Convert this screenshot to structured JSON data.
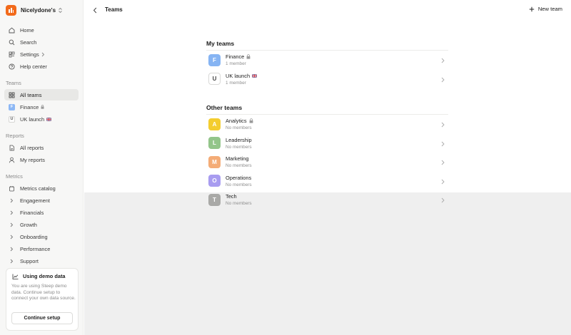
{
  "workspace": {
    "name": "Nicelydone's",
    "accent": "#f26a1b"
  },
  "nav": {
    "home": "Home",
    "search": "Search",
    "settings": "Settings",
    "help": "Help center"
  },
  "teams_section": {
    "label": "Teams",
    "all_teams": "All teams",
    "items": [
      {
        "letter": "F",
        "name": "Finance",
        "bg": "#8db8f5"
      },
      {
        "letter": "U",
        "name": "UK launch"
      }
    ]
  },
  "reports_section": {
    "label": "Reports",
    "all_reports": "All reports",
    "my_reports": "My reports"
  },
  "metrics_section": {
    "label": "Metrics",
    "catalog": "Metrics catalog",
    "groups": [
      "Engagement",
      "Financials",
      "Growth",
      "Onboarding",
      "Performance",
      "Support"
    ]
  },
  "demo": {
    "title": "Using demo data",
    "text": "You are using Steep demo data. Continue setup to connect your own data source.",
    "button": "Continue setup"
  },
  "header": {
    "title": "Teams",
    "new_team": "New team"
  },
  "my_teams": {
    "title": "My teams",
    "rows": [
      {
        "letter": "F",
        "name": "Finance",
        "sub": "1 member",
        "color": "#86b4f3"
      },
      {
        "letter": "U",
        "name": "UK launch",
        "sub": "1 member"
      }
    ]
  },
  "other_teams": {
    "title": "Other teams",
    "rows": [
      {
        "letter": "A",
        "name": "Analytics",
        "sub": "No members",
        "color": "#f4cd2f"
      },
      {
        "letter": "L",
        "name": "Leadership",
        "sub": "No members",
        "color": "#93c58a"
      },
      {
        "letter": "M",
        "name": "Marketing",
        "sub": "No members",
        "color": "#f4ac77"
      },
      {
        "letter": "O",
        "name": "Operations",
        "sub": "No members",
        "color": "#a89cf0"
      },
      {
        "letter": "T",
        "name": "Tech",
        "sub": "No members",
        "color": "#a9a9a7"
      }
    ]
  }
}
